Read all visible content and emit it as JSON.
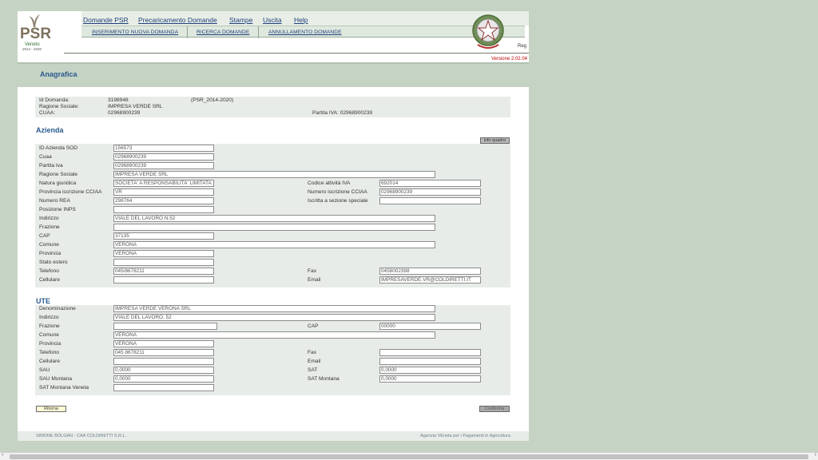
{
  "logo": {
    "text": "PSR",
    "sub1": "Veneto",
    "sub2": "2014 - 2020"
  },
  "menu": {
    "items": [
      "Domande PSR",
      "Precaricamento Domande",
      "Stampe",
      "Uscita",
      "Help"
    ]
  },
  "submenu": {
    "items": [
      "INSERIMENTO NUOVA DOMANDA",
      "RICERCA DOMANDE",
      "ANNULLAMENTO DOMANDE"
    ]
  },
  "header": {
    "right_cut_text": "Reg",
    "version": "Versione 2.02.04"
  },
  "page": {
    "title": "Anagrafica"
  },
  "summary": {
    "id_domanda_label": "Id Domanda:",
    "id_domanda": "3198948",
    "programma": "(PSR_2014-2020)",
    "ragione_label": "Ragione Sociale:",
    "ragione": "IMPRESA VERDE SRL",
    "cuaa_label": "CUAA:",
    "cuaa": "02968900239",
    "piva_text": "Partita IVA: 02968900239"
  },
  "azienda": {
    "title": "Azienda",
    "info_button": "info quadro",
    "fields": {
      "id_sod": {
        "label": "ID Azienda SOD",
        "value": "156573"
      },
      "cuaa": {
        "label": "Cuaa",
        "value": "02968900239"
      },
      "piva": {
        "label": "Partita Iva",
        "value": "02968900239"
      },
      "ragione": {
        "label": "Ragione Sociale",
        "value": "IMPRESA VERDE SRL"
      },
      "natura": {
        "label": "Natura giuridica",
        "value": "SOCIETA' A RESPONSABILITA' LIMITATA"
      },
      "codice_iva": {
        "label": "Codice attività IVA",
        "value": "692014"
      },
      "prov_cciaa": {
        "label": "Provincia iscrizione CCIAA",
        "value": "VR"
      },
      "num_cciaa": {
        "label": "Numero iscrizione CCIAA",
        "value": "02968900239"
      },
      "rea": {
        "label": "Numero REA",
        "value": "298764"
      },
      "sezione": {
        "label": "Iscritta a sezione speciale",
        "value": ""
      },
      "inps": {
        "label": "Posizione INPS",
        "value": ""
      },
      "indirizzo": {
        "label": "Indirizzo",
        "value": "VIALE DEL LAVORO N.52"
      },
      "frazione": {
        "label": "Frazione",
        "value": ""
      },
      "cap": {
        "label": "CAP",
        "value": "37135"
      },
      "comune": {
        "label": "Comune",
        "value": "VERONA"
      },
      "provincia": {
        "label": "Provincia",
        "value": "VERONA"
      },
      "stato": {
        "label": "Stato estero",
        "value": ""
      },
      "telefono": {
        "label": "Telefono",
        "value": "045/8678211"
      },
      "fax": {
        "label": "Fax",
        "value": "0458002398"
      },
      "cellulare": {
        "label": "Cellulare",
        "value": ""
      },
      "email": {
        "label": "Email",
        "value": "IMPRESAVERDE.VR@COLDIRETTI.IT"
      }
    }
  },
  "ute": {
    "title": "UTE",
    "fields": {
      "denominazione": {
        "label": "Denominazione",
        "value": "IMPRESA VERDE VERONA SRL"
      },
      "indirizzo": {
        "label": "Indirizzo",
        "value": "VIALE DEL LAVORO, 52"
      },
      "frazione": {
        "label": "Frazione",
        "value": ""
      },
      "cap": {
        "label": "CAP",
        "value": "00000"
      },
      "comune": {
        "label": "Comune",
        "value": "VERONA"
      },
      "provincia": {
        "label": "Provincia",
        "value": "VERONA"
      },
      "telefono": {
        "label": "Telefono",
        "value": "045 8678211"
      },
      "fax": {
        "label": "Fax",
        "value": ""
      },
      "cellulare": {
        "label": "Cellulare",
        "value": ""
      },
      "email": {
        "label": "Email",
        "value": ""
      },
      "sau": {
        "label": "SAU",
        "value": "0,0000"
      },
      "sat": {
        "label": "SAT",
        "value": "0,0000"
      },
      "sau_montana": {
        "label": "SAU Montana",
        "value": "0,0000"
      },
      "sat_montana": {
        "label": "SAT Montana",
        "value": "0,0000"
      },
      "sat_montana_veneta": {
        "label": "SAT Montana Veneta",
        "value": ""
      }
    }
  },
  "buttons": {
    "ritorna": "Ritorna",
    "conferma": "Conferma"
  },
  "footer": {
    "left": "SIMONE BOLGAN - CAA COLDIRETTI S.R.L.",
    "right": "Agenzia VEneta per i Pagamenti in Agricoltura"
  },
  "colors": {
    "accent": "#2b5a8d",
    "background": "#c5d3c5",
    "version": "#c20000"
  }
}
